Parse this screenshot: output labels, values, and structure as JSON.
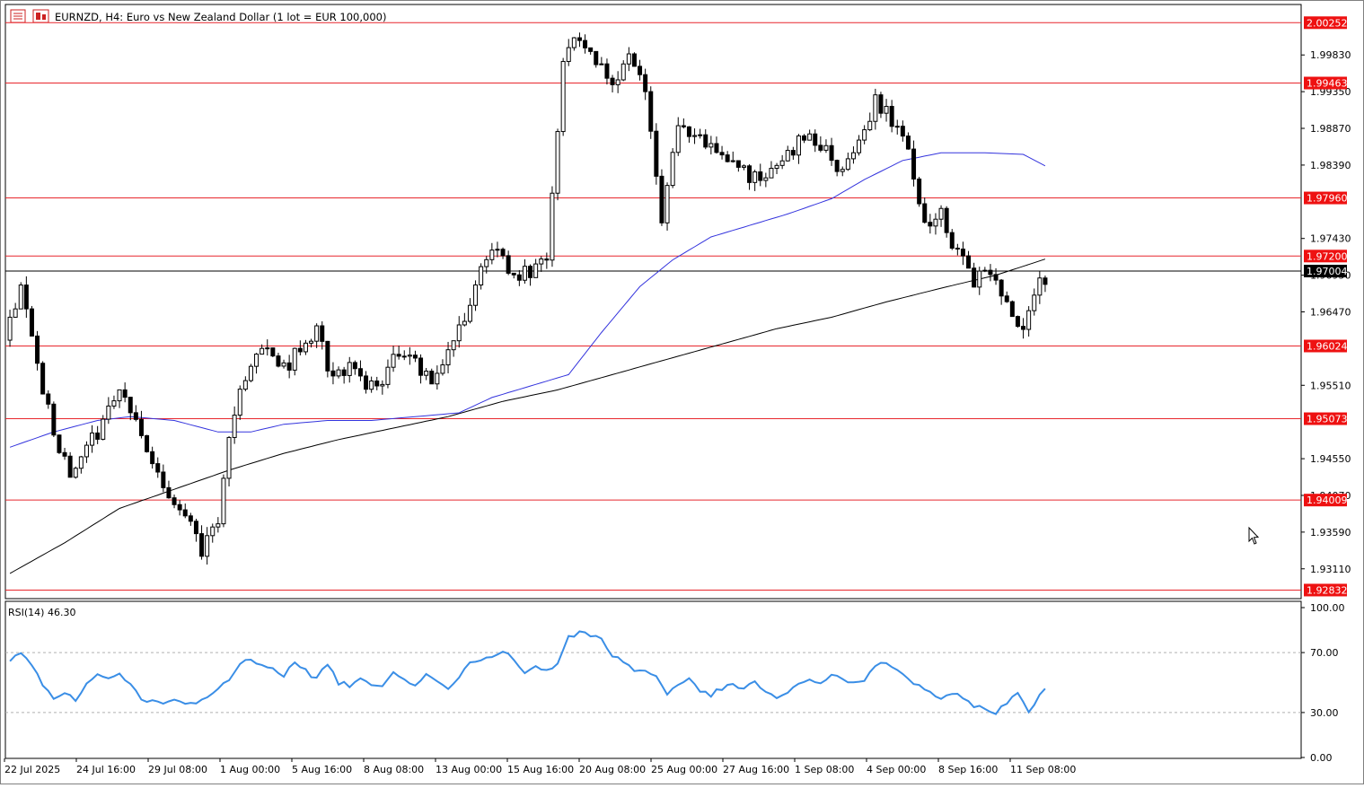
{
  "header": {
    "symbol_title": "EURNZD, H4:  Euro vs New Zealand Dollar (1 lot = EUR 100,000)"
  },
  "rsi_panel": {
    "label": "RSI(14) 46.30"
  },
  "colors": {
    "candle": "#000000",
    "level_line": "#e8272d",
    "level_tag_bg": "#ee1111",
    "ma_fast": "#3333dd",
    "ma_slow": "#000000",
    "rsi_line": "#3a8ee6",
    "current_price_tag_bg": "#000000"
  },
  "chart_data": [
    {
      "type": "candlestick",
      "title": "EURNZD, H4",
      "price_axis_ticks": [
        "1.99830",
        "1.99350",
        "1.98870",
        "1.98390",
        "1.97430",
        "1.96950",
        "1.96470",
        "1.95510",
        "1.94550",
        "1.94070",
        "1.93590",
        "1.93110"
      ],
      "ylim": [
        1.9272,
        2.0049
      ],
      "time_axis_labels": [
        "22 Jul 2025",
        "24 Jul 16:00",
        "29 Jul 08:00",
        "1 Aug 00:00",
        "5 Aug 16:00",
        "8 Aug 08:00",
        "13 Aug 00:00",
        "15 Aug 16:00",
        "20 Aug 08:00",
        "25 Aug 00:00",
        "27 Aug 16:00",
        "1 Sep 08:00",
        "4 Sep 00:00",
        "8 Sep 16:00",
        "11 Sep 08:00"
      ],
      "horizontal_levels": [
        2.00252,
        1.99463,
        1.9796,
        1.972,
        1.96024,
        1.95073,
        1.94009,
        1.92832
      ],
      "level_labels": [
        "2.00252",
        "1.99463",
        "1.97960",
        "1.97200",
        "1.96024",
        "1.95073",
        "1.94009",
        "1.92832"
      ],
      "current_price": 1.97004,
      "current_price_label": "1.97004",
      "price_path": [
        [
          0,
          1.961
        ],
        [
          3,
          1.968
        ],
        [
          6,
          1.958
        ],
        [
          9,
          1.949
        ],
        [
          12,
          1.944
        ],
        [
          15,
          1.947
        ],
        [
          18,
          1.95
        ],
        [
          21,
          1.954
        ],
        [
          24,
          1.951
        ],
        [
          27,
          1.945
        ],
        [
          30,
          1.94
        ],
        [
          33,
          1.938
        ],
        [
          36,
          1.933
        ],
        [
          39,
          1.938
        ],
        [
          42,
          1.952
        ],
        [
          45,
          1.958
        ],
        [
          48,
          1.96
        ],
        [
          51,
          1.957
        ],
        [
          54,
          1.96
        ],
        [
          57,
          1.962
        ],
        [
          60,
          1.956
        ],
        [
          63,
          1.958
        ],
        [
          66,
          1.955
        ],
        [
          69,
          1.956
        ],
        [
          72,
          1.96
        ],
        [
          75,
          1.958
        ],
        [
          78,
          1.956
        ],
        [
          81,
          1.96
        ],
        [
          84,
          1.963
        ],
        [
          87,
          1.97
        ],
        [
          90,
          1.973
        ],
        [
          93,
          1.969
        ],
        [
          96,
          1.97
        ],
        [
          99,
          1.971
        ],
        [
          102,
          1.998
        ],
        [
          105,
          2.001
        ],
        [
          108,
          1.997
        ],
        [
          111,
          1.995
        ],
        [
          114,
          1.998
        ],
        [
          117,
          1.993
        ],
        [
          120,
          1.976
        ],
        [
          123,
          1.99
        ],
        [
          126,
          1.988
        ],
        [
          129,
          1.986
        ],
        [
          132,
          1.984
        ],
        [
          135,
          1.983
        ],
        [
          138,
          1.982
        ],
        [
          141,
          1.984
        ],
        [
          144,
          1.986
        ],
        [
          147,
          1.988
        ],
        [
          150,
          1.986
        ],
        [
          153,
          1.983
        ],
        [
          156,
          1.987
        ],
        [
          159,
          1.992
        ],
        [
          162,
          1.99
        ],
        [
          165,
          1.986
        ],
        [
          168,
          1.976
        ],
        [
          171,
          1.978
        ],
        [
          174,
          1.972
        ],
        [
          177,
          1.969
        ],
        [
          180,
          1.97
        ],
        [
          183,
          1.965
        ],
        [
          186,
          1.963
        ],
        [
          189,
          1.969
        ]
      ],
      "ma_fast_path": [
        [
          0,
          1.947
        ],
        [
          8,
          1.949
        ],
        [
          16,
          1.9505
        ],
        [
          22,
          1.951
        ],
        [
          30,
          1.9505
        ],
        [
          38,
          1.949
        ],
        [
          44,
          1.949
        ],
        [
          50,
          1.95
        ],
        [
          58,
          1.9505
        ],
        [
          66,
          1.9505
        ],
        [
          74,
          1.951
        ],
        [
          82,
          1.9515
        ],
        [
          88,
          1.9535
        ],
        [
          95,
          1.955
        ],
        [
          102,
          1.9565
        ],
        [
          108,
          1.962
        ],
        [
          115,
          1.968
        ],
        [
          121,
          1.9715
        ],
        [
          128,
          1.9745
        ],
        [
          135,
          1.976
        ],
        [
          142,
          1.9775
        ],
        [
          150,
          1.9795
        ],
        [
          156,
          1.982
        ],
        [
          163,
          1.9845
        ],
        [
          170,
          1.9855
        ],
        [
          178,
          1.9855
        ],
        [
          185,
          1.9853
        ],
        [
          189,
          1.9838
        ]
      ],
      "ma_slow_path": [
        [
          0,
          1.9305
        ],
        [
          10,
          1.9345
        ],
        [
          20,
          1.939
        ],
        [
          30,
          1.9415
        ],
        [
          40,
          1.944
        ],
        [
          50,
          1.9462
        ],
        [
          60,
          1.948
        ],
        [
          70,
          1.9495
        ],
        [
          80,
          1.951
        ],
        [
          90,
          1.953
        ],
        [
          100,
          1.9545
        ],
        [
          110,
          1.9565
        ],
        [
          120,
          1.9585
        ],
        [
          130,
          1.9605
        ],
        [
          140,
          1.9625
        ],
        [
          150,
          1.964
        ],
        [
          160,
          1.966
        ],
        [
          170,
          1.9678
        ],
        [
          180,
          1.9695
        ],
        [
          189,
          1.9716
        ]
      ]
    },
    {
      "type": "line",
      "title": "RSI(14) 46.30",
      "ylim": [
        0,
        100
      ],
      "y_ticks": [
        "100.00",
        "70.00",
        "30.00",
        "0.00"
      ],
      "reference_levels": [
        70,
        30
      ],
      "rsi_path": [
        [
          0,
          64
        ],
        [
          2,
          70
        ],
        [
          4,
          62
        ],
        [
          6,
          49
        ],
        [
          8,
          38
        ],
        [
          10,
          42
        ],
        [
          12,
          39
        ],
        [
          14,
          49
        ],
        [
          16,
          55
        ],
        [
          18,
          53
        ],
        [
          20,
          57
        ],
        [
          22,
          48
        ],
        [
          24,
          40
        ],
        [
          26,
          37
        ],
        [
          28,
          36
        ],
        [
          30,
          38
        ],
        [
          32,
          36
        ],
        [
          34,
          35
        ],
        [
          36,
          40
        ],
        [
          38,
          46
        ],
        [
          40,
          52
        ],
        [
          42,
          62
        ],
        [
          44,
          66
        ],
        [
          46,
          62
        ],
        [
          48,
          60
        ],
        [
          50,
          55
        ],
        [
          52,
          63
        ],
        [
          54,
          58
        ],
        [
          56,
          52
        ],
        [
          58,
          63
        ],
        [
          60,
          50
        ],
        [
          62,
          48
        ],
        [
          64,
          54
        ],
        [
          66,
          47
        ],
        [
          68,
          49
        ],
        [
          70,
          58
        ],
        [
          72,
          52
        ],
        [
          74,
          49
        ],
        [
          76,
          56
        ],
        [
          78,
          52
        ],
        [
          80,
          45
        ],
        [
          82,
          54
        ],
        [
          84,
          63
        ],
        [
          86,
          65
        ],
        [
          88,
          67
        ],
        [
          90,
          72
        ],
        [
          92,
          66
        ],
        [
          94,
          55
        ],
        [
          96,
          61
        ],
        [
          98,
          58
        ],
        [
          100,
          62
        ],
        [
          102,
          80
        ],
        [
          104,
          83
        ],
        [
          106,
          82
        ],
        [
          108,
          80
        ],
        [
          110,
          68
        ],
        [
          112,
          64
        ],
        [
          114,
          58
        ],
        [
          116,
          58
        ],
        [
          118,
          54
        ],
        [
          120,
          43
        ],
        [
          122,
          49
        ],
        [
          124,
          52
        ],
        [
          126,
          44
        ],
        [
          128,
          42
        ],
        [
          130,
          46
        ],
        [
          132,
          48
        ],
        [
          134,
          46
        ],
        [
          136,
          50
        ],
        [
          138,
          44
        ],
        [
          140,
          40
        ],
        [
          142,
          43
        ],
        [
          144,
          48
        ],
        [
          146,
          52
        ],
        [
          148,
          50
        ],
        [
          150,
          55
        ],
        [
          152,
          53
        ],
        [
          154,
          49
        ],
        [
          156,
          52
        ],
        [
          158,
          60
        ],
        [
          160,
          64
        ],
        [
          162,
          58
        ],
        [
          164,
          52
        ],
        [
          166,
          48
        ],
        [
          168,
          44
        ],
        [
          170,
          38
        ],
        [
          172,
          42
        ],
        [
          174,
          40
        ],
        [
          176,
          35
        ],
        [
          178,
          32
        ],
        [
          180,
          30
        ],
        [
          182,
          37
        ],
        [
          184,
          42
        ],
        [
          186,
          31
        ],
        [
          188,
          42
        ],
        [
          189,
          47
        ]
      ]
    }
  ]
}
